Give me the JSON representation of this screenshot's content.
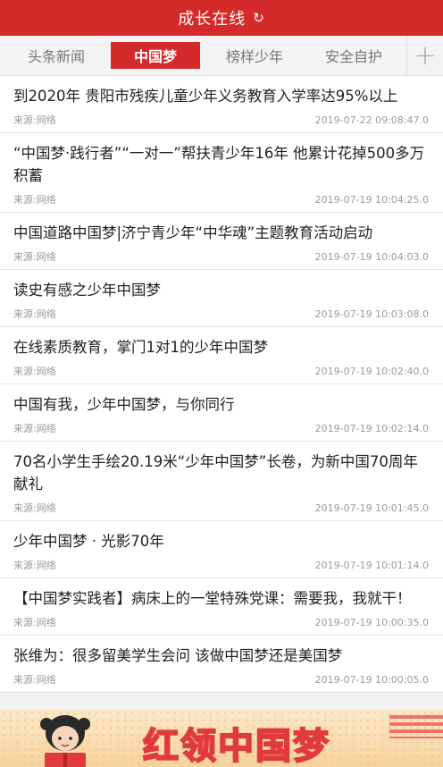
{
  "header": {
    "title": "成长在线",
    "refresh_icon": "↻"
  },
  "tabs": [
    {
      "label": "头条新闻"
    },
    {
      "label": "中国梦"
    },
    {
      "label": "榜样少年"
    },
    {
      "label": "安全自护"
    }
  ],
  "add_icon": "+",
  "articles": [
    {
      "title": "到2020年 贵阳市残疾儿童少年义务教育入学率达95%以上",
      "source": "来源:网络",
      "time": "2019-07-22 09:08:47.0"
    },
    {
      "title": "“中国梦·践行者”“一对一”帮扶青少年16年 他累计花掉500多万积蓄",
      "source": "来源:网络",
      "time": "2019-07-19 10:04:25.0"
    },
    {
      "title": "中国道路中国梦|济宁青少年“中华魂”主题教育活动启动",
      "source": "来源:网络",
      "time": "2019-07-19 10:04:03.0"
    },
    {
      "title": "读史有感之少年中国梦",
      "source": "来源:网络",
      "time": "2019-07-19 10:03:08.0"
    },
    {
      "title": "在线素质教育，掌门1对1的少年中国梦",
      "source": "来源:网络",
      "time": "2019-07-19 10:02:40.0"
    },
    {
      "title": "中国有我，少年中国梦，与你同行",
      "source": "来源:网络",
      "time": "2019-07-19 10:02:14.0"
    },
    {
      "title": "70名小学生手绘20.19米“少年中国梦”长卷，为新中国70周年献礼",
      "source": "来源:网络",
      "time": "2019-07-19 10:01:45.0"
    },
    {
      "title": "少年中国梦 · 光影70年",
      "source": "来源:网络",
      "time": "2019-07-19 10:01:14.0"
    },
    {
      "title": "【中国梦实践者】病床上的一堂特殊党课：需要我，我就干！",
      "source": "来源:网络",
      "time": "2019-07-19 10:00:35.0"
    },
    {
      "title": "张维为：很多留美学生会问 该做中国梦还是美国梦",
      "source": "来源:网络",
      "time": "2019-07-19 10:00:05.0"
    }
  ],
  "banner": {
    "slogan": "红领中国梦"
  },
  "colors": {
    "brand_red": "#d42a2a"
  }
}
